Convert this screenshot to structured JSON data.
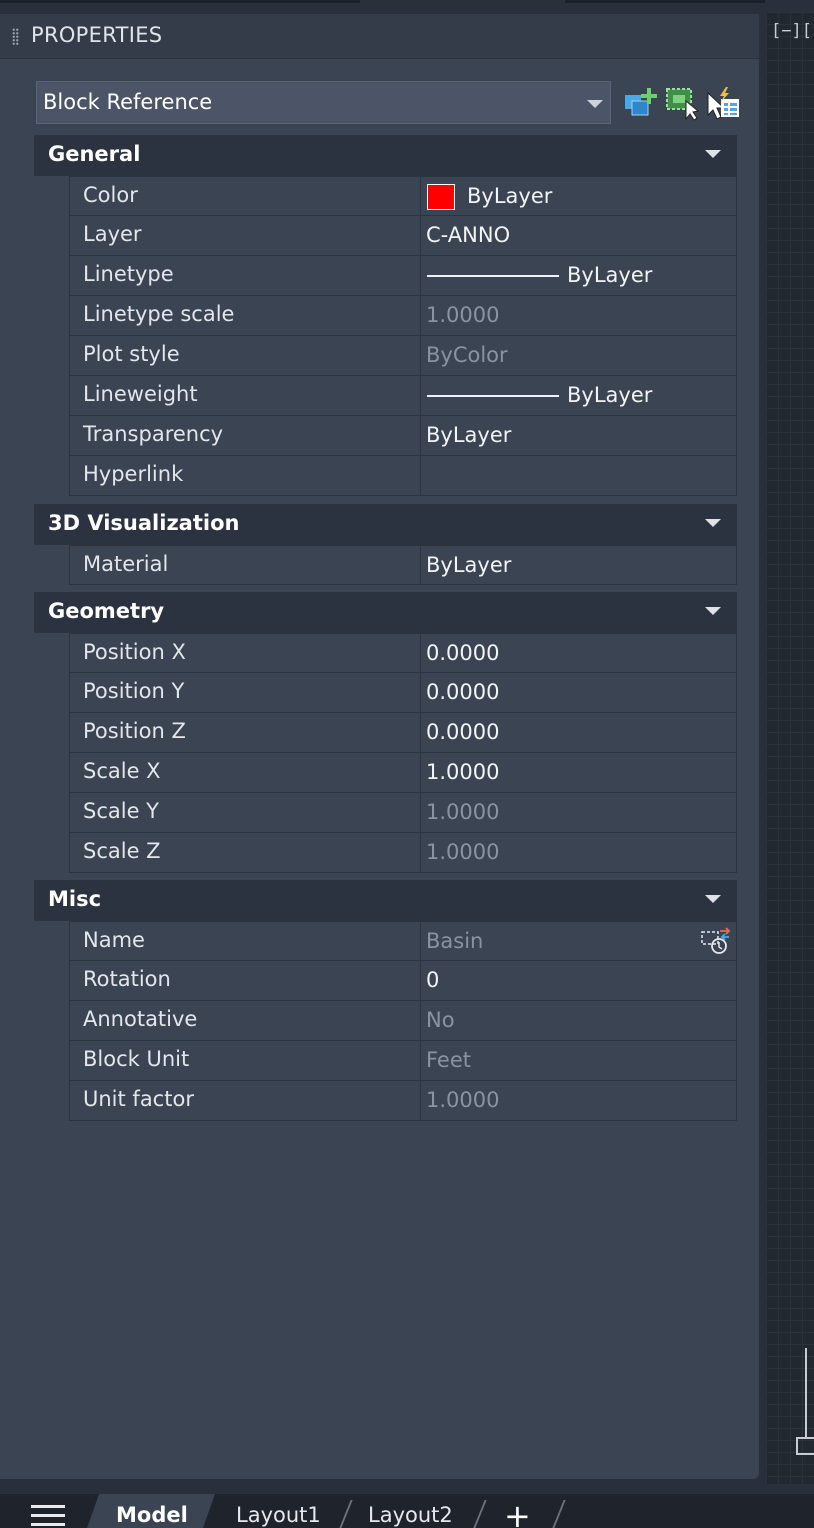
{
  "panel": {
    "title": "PROPERTIES",
    "object_type": "Block Reference",
    "viewport_label": "[−][",
    "toolbar_icons": [
      "quick-select-icon",
      "select-objects-icon",
      "toggle-pickadd-icon"
    ]
  },
  "sections": {
    "general": {
      "title": "General",
      "rows": [
        {
          "name": "Color",
          "value": "ByLayer",
          "swatch": "#ff0000"
        },
        {
          "name": "Layer",
          "value": "C-ANNO"
        },
        {
          "name": "Linetype",
          "value": "ByLayer"
        },
        {
          "name": "Linetype scale",
          "value": "1.0000"
        },
        {
          "name": "Plot style",
          "value": "ByColor"
        },
        {
          "name": "Lineweight",
          "value": "ByLayer"
        },
        {
          "name": "Transparency",
          "value": "ByLayer"
        },
        {
          "name": "Hyperlink",
          "value": ""
        }
      ]
    },
    "visualization": {
      "title": "3D Visualization",
      "rows": [
        {
          "name": "Material",
          "value": "ByLayer"
        }
      ]
    },
    "geometry": {
      "title": "Geometry",
      "rows": [
        {
          "name": "Position X",
          "value": "0.0000"
        },
        {
          "name": "Position Y",
          "value": "0.0000"
        },
        {
          "name": "Position Z",
          "value": "0.0000"
        },
        {
          "name": "Scale X",
          "value": "1.0000"
        },
        {
          "name": "Scale Y",
          "value": "1.0000"
        },
        {
          "name": "Scale Z",
          "value": "1.0000"
        }
      ]
    },
    "misc": {
      "title": "Misc",
      "rows": [
        {
          "name": "Name",
          "value": "Basin"
        },
        {
          "name": "Rotation",
          "value": "0"
        },
        {
          "name": "Annotative",
          "value": "No"
        },
        {
          "name": "Block Unit",
          "value": "Feet"
        },
        {
          "name": "Unit factor",
          "value": "1.0000"
        }
      ]
    }
  },
  "tabs": {
    "model": "Model",
    "layout1": "Layout1",
    "layout2": "Layout2",
    "add": "+"
  },
  "colors": {
    "panel_bg": "#3b4453",
    "section_bg": "#2b3240",
    "dim_text": "#8a93a0",
    "color_swatch": "#ff0000"
  }
}
